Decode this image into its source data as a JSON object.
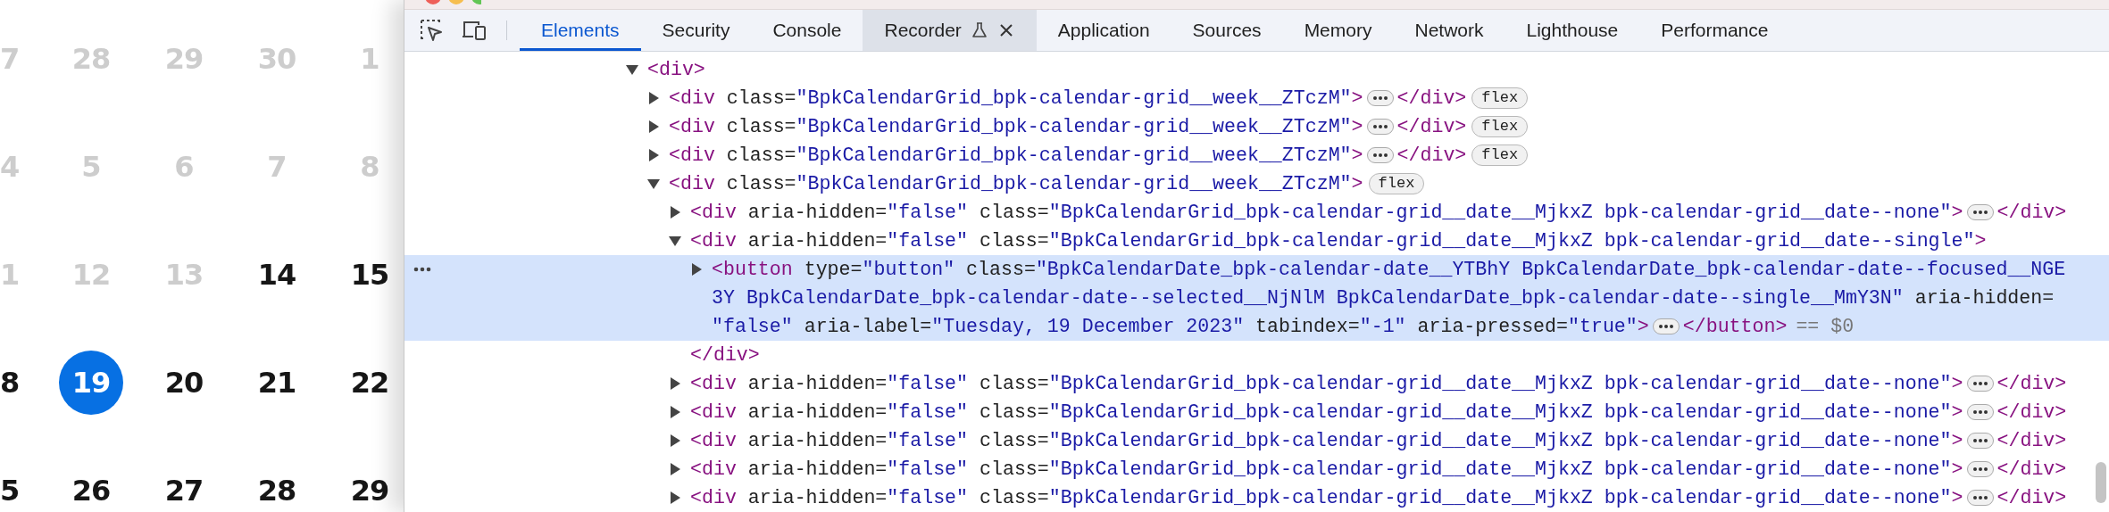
{
  "calendar": {
    "weeks": [
      [
        {
          "day": "7",
          "muted": true,
          "selected": false
        },
        {
          "day": "28",
          "muted": true,
          "selected": false
        },
        {
          "day": "29",
          "muted": true,
          "selected": false
        },
        {
          "day": "30",
          "muted": true,
          "selected": false
        },
        {
          "day": "1",
          "muted": true,
          "selected": false
        }
      ],
      [
        {
          "day": "4",
          "muted": true,
          "selected": false
        },
        {
          "day": "5",
          "muted": true,
          "selected": false
        },
        {
          "day": "6",
          "muted": true,
          "selected": false
        },
        {
          "day": "7",
          "muted": true,
          "selected": false
        },
        {
          "day": "8",
          "muted": true,
          "selected": false
        }
      ],
      [
        {
          "day": "1",
          "muted": true,
          "selected": false
        },
        {
          "day": "12",
          "muted": true,
          "selected": false
        },
        {
          "day": "13",
          "muted": true,
          "selected": false
        },
        {
          "day": "14",
          "muted": false,
          "selected": false
        },
        {
          "day": "15",
          "muted": false,
          "selected": false
        }
      ],
      [
        {
          "day": "8",
          "muted": false,
          "selected": false
        },
        {
          "day": "19",
          "muted": false,
          "selected": true
        },
        {
          "day": "20",
          "muted": false,
          "selected": false
        },
        {
          "day": "21",
          "muted": false,
          "selected": false
        },
        {
          "day": "22",
          "muted": false,
          "selected": false
        }
      ],
      [
        {
          "day": "5",
          "muted": false,
          "selected": false
        },
        {
          "day": "26",
          "muted": false,
          "selected": false
        },
        {
          "day": "27",
          "muted": false,
          "selected": false
        },
        {
          "day": "28",
          "muted": false,
          "selected": false
        },
        {
          "day": "29",
          "muted": false,
          "selected": false
        }
      ]
    ]
  },
  "devtools": {
    "tabs": [
      {
        "label": "Elements",
        "selected": true,
        "hovered": false,
        "experimental": false,
        "closable": false
      },
      {
        "label": "Security",
        "selected": false,
        "hovered": false,
        "experimental": false,
        "closable": false
      },
      {
        "label": "Console",
        "selected": false,
        "hovered": false,
        "experimental": false,
        "closable": false
      },
      {
        "label": "Recorder",
        "selected": false,
        "hovered": true,
        "experimental": true,
        "closable": true
      },
      {
        "label": "Application",
        "selected": false,
        "hovered": false,
        "experimental": false,
        "closable": false
      },
      {
        "label": "Sources",
        "selected": false,
        "hovered": false,
        "experimental": false,
        "closable": false
      },
      {
        "label": "Memory",
        "selected": false,
        "hovered": false,
        "experimental": false,
        "closable": false
      },
      {
        "label": "Network",
        "selected": false,
        "hovered": false,
        "experimental": false,
        "closable": false
      },
      {
        "label": "Lighthouse",
        "selected": false,
        "hovered": false,
        "experimental": false,
        "closable": false
      },
      {
        "label": "Performance",
        "selected": false,
        "hovered": false,
        "experimental": false,
        "closable": false
      }
    ],
    "dom_tree": [
      {
        "open": "<div>",
        "expanded": true,
        "selected": false,
        "children": [
          {
            "open": "<div class=\"BpkCalendarGrid_bpk-calendar-grid__week__ZTczM\">",
            "expanded": false,
            "selected": false,
            "close": "</div>",
            "badge": "flex"
          },
          {
            "open": "<div class=\"BpkCalendarGrid_bpk-calendar-grid__week__ZTczM\">",
            "expanded": false,
            "selected": false,
            "close": "</div>",
            "badge": "flex"
          },
          {
            "open": "<div class=\"BpkCalendarGrid_bpk-calendar-grid__week__ZTczM\">",
            "expanded": false,
            "selected": false,
            "close": "</div>",
            "badge": "flex"
          },
          {
            "open": "<div class=\"BpkCalendarGrid_bpk-calendar-grid__week__ZTczM\">",
            "expanded": true,
            "selected": false,
            "badge": "flex",
            "children": [
              {
                "open": "<div aria-hidden=\"false\" class=\"BpkCalendarGrid_bpk-calendar-grid__date__MjkxZ bpk-calendar-grid__date--none\">",
                "expanded": false,
                "selected": false,
                "close": "</div>"
              },
              {
                "open": "<div aria-hidden=\"false\" class=\"BpkCalendarGrid_bpk-calendar-grid__date__MjkxZ bpk-calendar-grid__date--single\">",
                "expanded": true,
                "selected": false,
                "close": "</div>",
                "children": [
                  {
                    "open_lines": [
                      "<button type=\"button\" class=\"BpkCalendarDate_bpk-calendar-date__YTBhY BpkCalendarDate_bpk-calendar-date--focused__NGE",
                      "3Y BpkCalendarDate_bpk-calendar-date--selected__NjNlM BpkCalendarDate_bpk-calendar-date--single__MmY3N\" aria-hidden=",
                      "\"false\" aria-label=\"Tuesday, 19 December 2023\" tabindex=\"-1\" aria-pressed=\"true\">"
                    ],
                    "expanded": false,
                    "selected": true,
                    "close": "</button>",
                    "console_ref": "== $0"
                  }
                ]
              },
              {
                "open": "<div aria-hidden=\"false\" class=\"BpkCalendarGrid_bpk-calendar-grid__date__MjkxZ bpk-calendar-grid__date--none\">",
                "expanded": false,
                "selected": false,
                "close": "</div>"
              },
              {
                "open": "<div aria-hidden=\"false\" class=\"BpkCalendarGrid_bpk-calendar-grid__date__MjkxZ bpk-calendar-grid__date--none\">",
                "expanded": false,
                "selected": false,
                "close": "</div>"
              },
              {
                "open": "<div aria-hidden=\"false\" class=\"BpkCalendarGrid_bpk-calendar-grid__date__MjkxZ bpk-calendar-grid__date--none\">",
                "expanded": false,
                "selected": false,
                "close": "</div>"
              },
              {
                "open": "<div aria-hidden=\"false\" class=\"BpkCalendarGrid_bpk-calendar-grid__date__MjkxZ bpk-calendar-grid__date--none\">",
                "expanded": false,
                "selected": false,
                "close": "</div>"
              },
              {
                "open": "<div aria-hidden=\"false\" class=\"BpkCalendarGrid_bpk-calendar-grid__date__MjkxZ bpk-calendar-grid__date--none\">",
                "expanded": false,
                "selected": false,
                "close": "</div>"
              }
            ]
          }
        ]
      }
    ]
  }
}
